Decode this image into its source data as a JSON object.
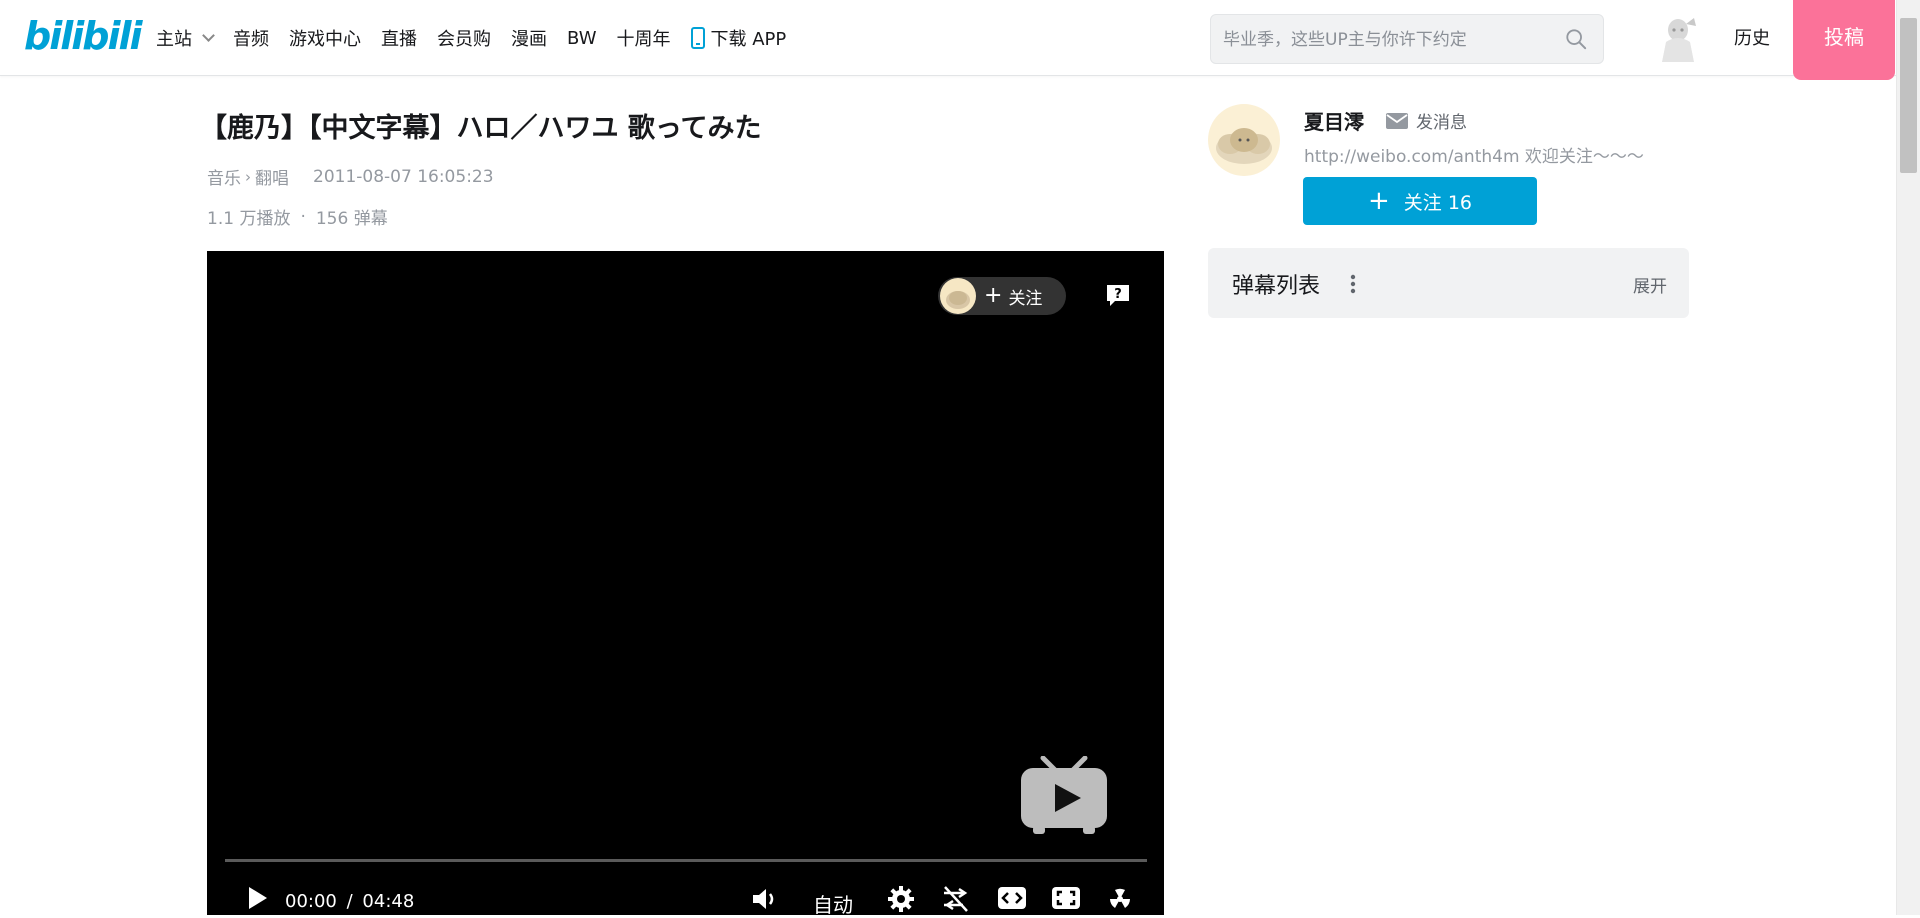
{
  "header": {
    "logo": "bilibili",
    "nav": [
      {
        "label": "主站"
      },
      {
        "label": "音频"
      },
      {
        "label": "游戏中心"
      },
      {
        "label": "直播"
      },
      {
        "label": "会员购"
      },
      {
        "label": "漫画"
      },
      {
        "label": "BW"
      },
      {
        "label": "十周年"
      },
      {
        "label": "下载 APP"
      }
    ],
    "search_placeholder": "毕业季，这些UP主与你许下约定",
    "history": "历史",
    "upload": "投稿"
  },
  "video": {
    "title": "【鹿乃】【中文字幕】ハロ／ハワユ 歌ってみた",
    "category": "音乐",
    "subcategory": "翻唱",
    "date": "2011-08-07 16:05:23",
    "plays": "1.1 万播放",
    "danmaku_count": "156 弹幕"
  },
  "player": {
    "follow_label": "关注",
    "current_time": "00:00",
    "time_sep": "/",
    "duration": "04:48",
    "quality": "自动"
  },
  "uploader": {
    "name": "夏目澪",
    "message": "发消息",
    "description": "http://weibo.com/anth4m 欢迎关注～～～",
    "follow_button": "关注 16"
  },
  "danmaku_list": {
    "title": "弹幕列表",
    "expand": "展开"
  },
  "colors": {
    "brand_blue": "#00a1d6",
    "brand_pink": "#fb7299"
  }
}
